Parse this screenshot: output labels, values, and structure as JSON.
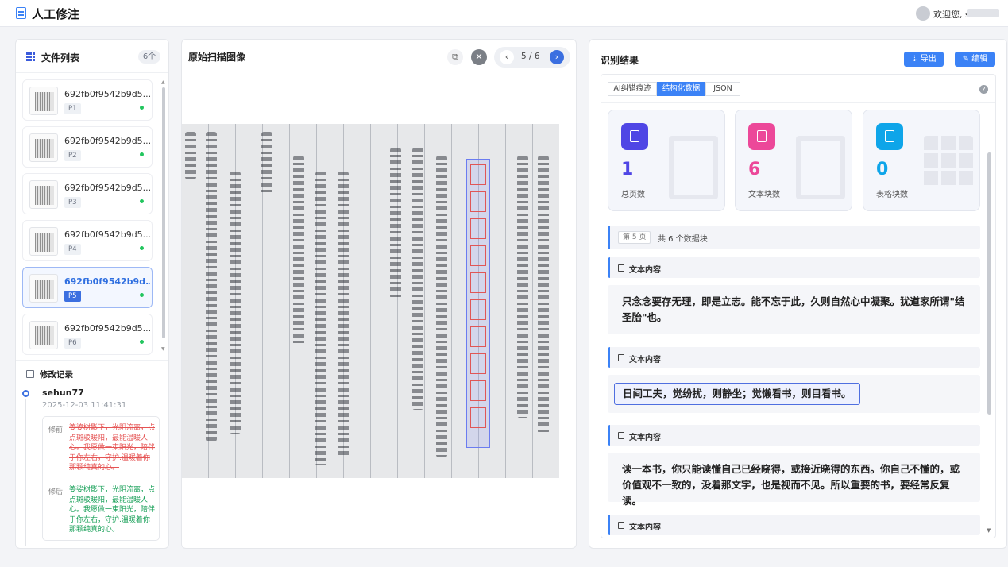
{
  "header": {
    "title": "人工修注",
    "welcome": "欢迎您, s"
  },
  "file_list": {
    "title": "文件列表",
    "count": "6个",
    "files": [
      {
        "name": "692fb0f9542b9d5...",
        "page": "P1"
      },
      {
        "name": "692fb0f9542b9d5...",
        "page": "P2"
      },
      {
        "name": "692fb0f9542b9d5...",
        "page": "P3"
      },
      {
        "name": "692fb0f9542b9d5...",
        "page": "P4"
      },
      {
        "name": "692fb0f9542b9d...",
        "page": "P5",
        "active": true
      },
      {
        "name": "692fb0f9542b9d5...",
        "page": "P6"
      }
    ]
  },
  "history": {
    "title": "修改记录",
    "user": "sehun77",
    "time": "2025-12-03 11:41:31",
    "before_label": "修前:",
    "before_text": "婆婆树影下，光阴流离，点点斑驳暖阳，最能温暖人心。我愿做一束阳光，陪伴于你左右，守护.温暖着你那颗纯真的心。",
    "after_label": "修后:",
    "after_text": "婆娑树影下，光阴流离，点点斑驳暖阳，最能温暖人心。我愿做一束阳光，陪伴于你左右，守护.温暖着你那颗纯真的心。"
  },
  "scan": {
    "title": "原始扫描图像",
    "copy_icon": "copy-icon",
    "close_icon": "close-icon",
    "pager": "5 / 6"
  },
  "result": {
    "title": "识别结果",
    "export_label": "⇣ 导出",
    "edit_label": "✎ 编辑",
    "tabs": [
      "AI纠错痕迹",
      "结构化数据",
      "JSON"
    ],
    "active_tab": 1,
    "stats": [
      {
        "value": "1",
        "label": "总页数",
        "color": "#4f46e5"
      },
      {
        "value": "6",
        "label": "文本块数",
        "color": "#ec4899"
      },
      {
        "value": "0",
        "label": "表格块数",
        "color": "#0ea5e9"
      }
    ],
    "page_tag": "第 5 页",
    "page_total": "共 6 个数据块",
    "blocks": [
      {
        "heading": "文本内容",
        "text": "只念念要存无理，即是立志。能不忘于此，久则自然心中凝聚。犹道家所谓\"结圣胎\"也。"
      },
      {
        "heading": "文本内容",
        "text": "日间工夫，觉纷扰，则静坐；觉懒看书，则目看书。",
        "selected": true
      },
      {
        "heading": "文本内容",
        "text": "读一本书，你只能读懂自己已经晓得，或接近晓得的东西。你自己不懂的，或价值观不一致的，没着那文字，也是视而不见。所以重要的书，要经常反复读。"
      },
      {
        "heading": "文本内容"
      }
    ]
  }
}
